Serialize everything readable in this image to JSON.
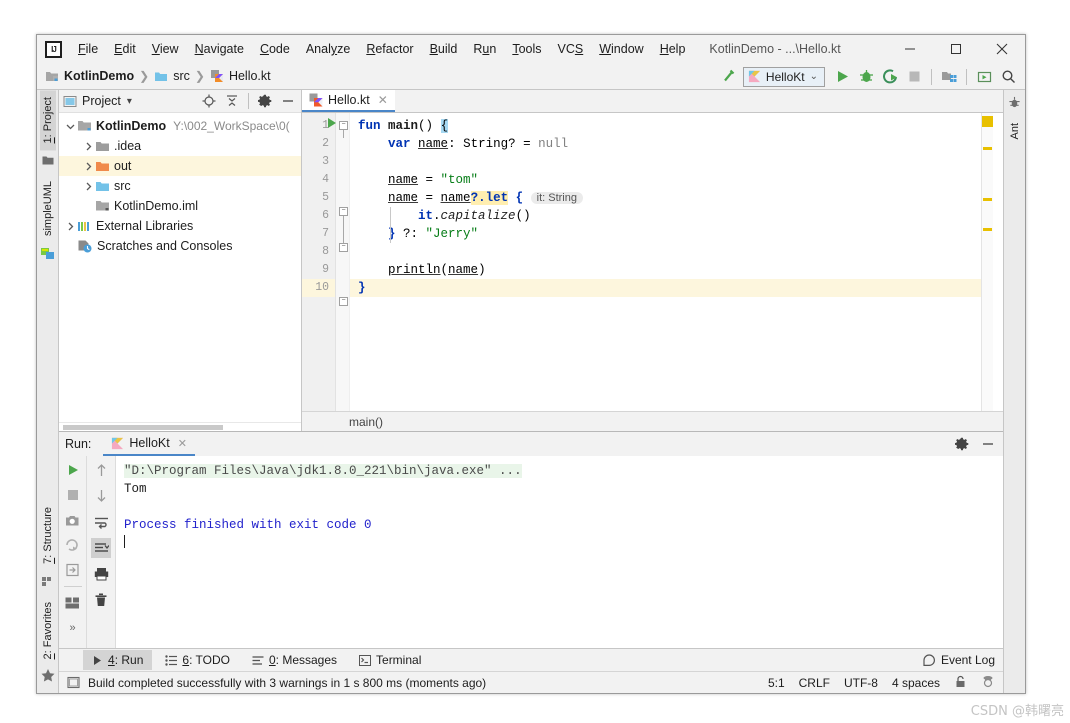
{
  "window": {
    "title": "KotlinDemo - ...\\Hello.kt",
    "logo_text": "IJ",
    "minimize": "−",
    "maximize": "□",
    "close": "✕"
  },
  "menu": [
    {
      "label": "File",
      "mnemonic": "F"
    },
    {
      "label": "Edit",
      "mnemonic": "E"
    },
    {
      "label": "View",
      "mnemonic": "V"
    },
    {
      "label": "Navigate",
      "mnemonic": "N"
    },
    {
      "label": "Code",
      "mnemonic": "C"
    },
    {
      "label": "Analyze",
      "mnemonic": "y"
    },
    {
      "label": "Refactor",
      "mnemonic": "R"
    },
    {
      "label": "Build",
      "mnemonic": "B"
    },
    {
      "label": "Run",
      "mnemonic": "u"
    },
    {
      "label": "Tools",
      "mnemonic": "T"
    },
    {
      "label": "VCS",
      "mnemonic": "S"
    },
    {
      "label": "Window",
      "mnemonic": "W"
    },
    {
      "label": "Help",
      "mnemonic": "H"
    }
  ],
  "navbar": {
    "breadcrumbs": [
      "KotlinDemo",
      "src",
      "Hello.kt"
    ],
    "separator": "❯",
    "run_config": "HelloKt",
    "dropdown_caret": "⌄"
  },
  "left_tool_tabs": [
    {
      "label": "1: Project",
      "selected": true
    },
    {
      "label": "simpleUML",
      "selected": false
    },
    {
      "label": "7: Structure",
      "selected": false
    },
    {
      "label": "2: Favorites",
      "selected": false
    }
  ],
  "right_tool_tabs": [
    {
      "label": "Ant"
    }
  ],
  "project_panel": {
    "title": "Project",
    "dropdown_caret": "▾",
    "tree": [
      {
        "label": "KotlinDemo",
        "path": "Y:\\002_WorkSpace\\0(",
        "depth": 0,
        "arrow": "expanded",
        "icon": "module-icon",
        "bold": true,
        "highlight": false
      },
      {
        "label": ".idea",
        "path": "",
        "depth": 1,
        "arrow": "collapsed",
        "icon": "folder-gray-icon",
        "bold": false,
        "highlight": false
      },
      {
        "label": "out",
        "path": "",
        "depth": 1,
        "arrow": "collapsed",
        "icon": "folder-orange-icon",
        "bold": false,
        "highlight": true
      },
      {
        "label": "src",
        "path": "",
        "depth": 1,
        "arrow": "collapsed",
        "icon": "folder-blue-icon",
        "bold": false,
        "highlight": false
      },
      {
        "label": "KotlinDemo.iml",
        "path": "",
        "depth": 2,
        "arrow": "none",
        "icon": "iml-icon",
        "bold": false,
        "highlight": false
      },
      {
        "label": "External Libraries",
        "path": "",
        "depth": 0,
        "arrow": "collapsed",
        "icon": "libraries-icon",
        "bold": false,
        "highlight": false
      },
      {
        "label": "Scratches and Consoles",
        "path": "",
        "depth": 0,
        "arrow": "none",
        "icon": "scratches-icon",
        "bold": false,
        "highlight": false
      }
    ]
  },
  "editor": {
    "tab_label": "Hello.kt",
    "tab_close": "✕",
    "breadcrumb": "main()",
    "line_numbers": [
      "1",
      "2",
      "3",
      "4",
      "5",
      "6",
      "7",
      "8",
      "9",
      "10"
    ],
    "current_line_index": 9,
    "code_lines": [
      "fun main() {",
      "    var name: String? = null",
      "",
      "    name = \"tom\"",
      "    name = name?.let { it: String",
      "        it.capitalize()",
      "    } ?: \"Jerry\"",
      "",
      "    println(name)",
      "}"
    ],
    "inlay_hint": "it: String"
  },
  "run_window": {
    "label": "Run:",
    "tab_label": "HelloKt",
    "tab_close": "✕",
    "console_lines": [
      {
        "text": "\"D:\\Program Files\\Java\\jdk1.8.0_221\\bin\\java.exe\" ...",
        "style": "cmd"
      },
      {
        "text": "Tom",
        "style": "out"
      },
      {
        "text": "",
        "style": "out"
      },
      {
        "text": "Process finished with exit code 0",
        "style": "fin"
      }
    ]
  },
  "bottom_tabs": [
    {
      "label": "4: Run",
      "mnemonic": "4",
      "icon": "run-icon",
      "selected": true
    },
    {
      "label": "6: TODO",
      "mnemonic": "6",
      "icon": "todo-icon",
      "selected": false
    },
    {
      "label": "0: Messages",
      "mnemonic": "0",
      "icon": "messages-icon",
      "selected": false
    },
    {
      "label": "Terminal",
      "mnemonic": "",
      "icon": "terminal-icon",
      "selected": false
    }
  ],
  "event_log": "Event Log",
  "status": {
    "message": "Build completed successfully with 3 warnings in 1 s 800 ms (moments ago)",
    "caret_position": "5:1",
    "line_separator": "CRLF",
    "encoding": "UTF-8",
    "indent": "4 spaces"
  },
  "watermark": "CSDN @韩曙亮",
  "colors": {
    "accent_blue": "#4a86c8",
    "keyword_blue": "#0033b3",
    "string_green": "#067d17",
    "warning_yellow": "#e8c000",
    "highlight_row": "#fdf6dd",
    "run_green": "#4ca64c"
  }
}
